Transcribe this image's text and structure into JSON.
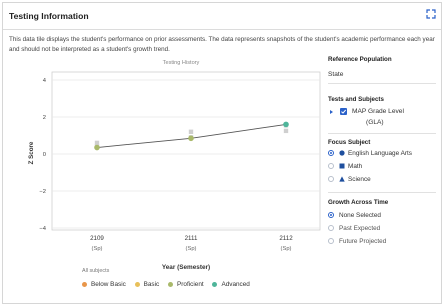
{
  "header": {
    "title": "Testing Information",
    "expand_icon": "expand-icon"
  },
  "description": "This data tile displays the student's performance on prior assessments. The data represents snapshots of the student's academic performance each year and should not be interpreted as a student's growth trend.",
  "chart": {
    "title": "Testing History",
    "ylabel": "Z Score",
    "xlabel": "Year (Semester)",
    "yticks": [
      "4",
      "2",
      "0",
      "−2",
      "−4"
    ],
    "categories": [
      {
        "year": "2109",
        "sem": "(Sp)"
      },
      {
        "year": "2111",
        "sem": "(Sp)"
      },
      {
        "year": "2112",
        "sem": "(Sp)"
      }
    ],
    "all_subjects_label": "All subjects",
    "legend": [
      {
        "label": "Below Basic",
        "color": "#e8964a"
      },
      {
        "label": "Basic",
        "color": "#e8c05a"
      },
      {
        "label": "Proficient",
        "color": "#a9b96a"
      },
      {
        "label": "Advanced",
        "color": "#4fb59a"
      }
    ]
  },
  "chart_data": {
    "type": "line",
    "title": "Testing History",
    "xlabel": "Year (Semester)",
    "ylabel": "Z Score",
    "categories": [
      "2109 (Sp)",
      "2111 (Sp)",
      "2112 (Sp)"
    ],
    "ylim": [
      -4,
      4
    ],
    "grid": "y",
    "series": [
      {
        "values": [
          0.35,
          0.85,
          1.6
        ],
        "point_colors": [
          "#a9b96a",
          "#a9b96a",
          "#4fb59a"
        ]
      }
    ],
    "grey_markers": [
      {
        "x": 0,
        "values": [
          0.6,
          0.4
        ]
      },
      {
        "x": 1,
        "values": [
          1.2,
          0.9
        ]
      },
      {
        "x": 2,
        "values": [
          1.25,
          1.55
        ]
      }
    ]
  },
  "side_panel": {
    "reference_population": {
      "title": "Reference Population",
      "value": "State"
    },
    "tests_subjects": {
      "title": "Tests and Subjects",
      "item": "MAP Grade Level",
      "item2": "(GLA)"
    },
    "focus_subject": {
      "title": "Focus Subject",
      "options": [
        {
          "label": "English Language Arts",
          "selected": true
        },
        {
          "label": "Math",
          "selected": false
        },
        {
          "label": "Science",
          "selected": false
        }
      ]
    },
    "growth": {
      "title": "Growth Across Time",
      "options": [
        {
          "label": "None Selected",
          "selected": true
        },
        {
          "label": "Past Expected",
          "selected": false
        },
        {
          "label": "Future Projected",
          "selected": false
        }
      ]
    }
  },
  "colors": {
    "accent": "#2a61c9",
    "line": "#555555",
    "grid": "#e6e6e6"
  }
}
